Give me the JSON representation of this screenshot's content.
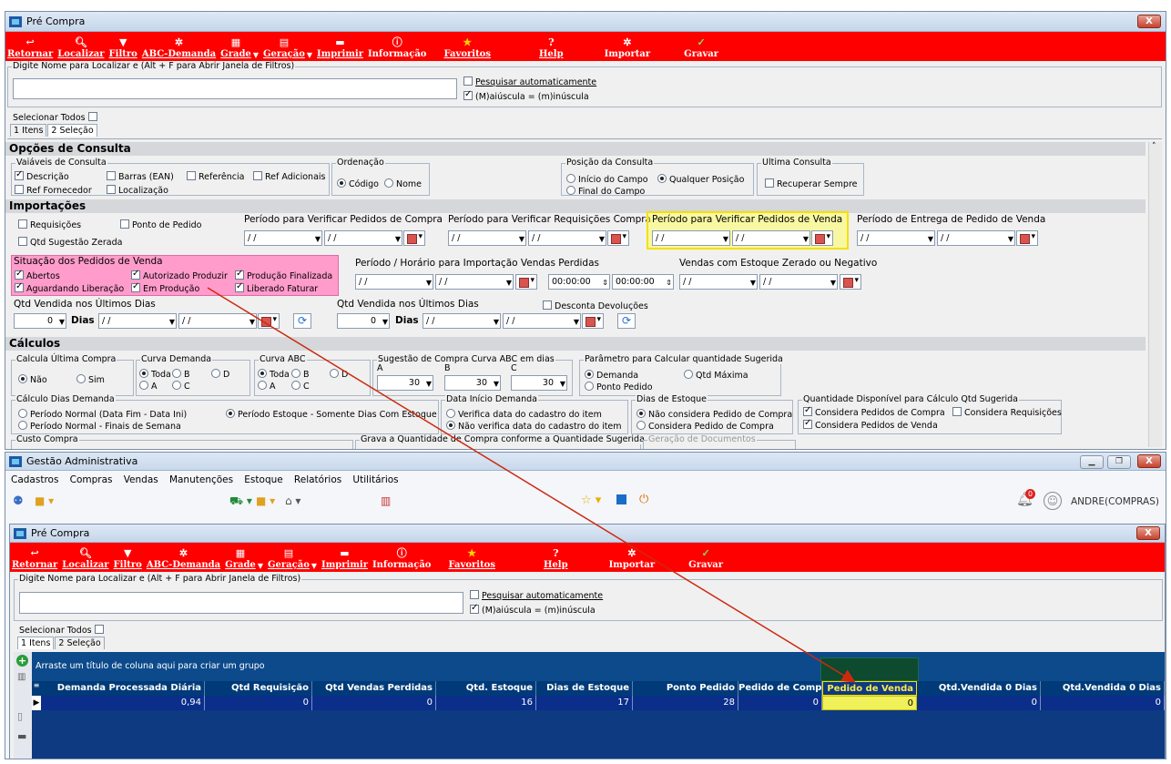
{
  "window_top": {
    "title": "Pré Compra",
    "close_label": "X",
    "toolbar": [
      "Retornar",
      "Localizar",
      "Filtro",
      "ABC-Demanda",
      "Grade",
      "Geração",
      "Imprimir",
      "Informação",
      "Favoritos",
      "Help",
      "Importar",
      "Gravar"
    ],
    "search_label": "Digite Nome para Localizar e (Alt + F para Abrir Janela de Filtros)",
    "auto_search": "Pesquisar automaticamente",
    "case_option": "(M)aiúscula = (m)inúscula",
    "select_all": "Selecionar Todos",
    "tabs": [
      "1 Itens",
      "2 Seleção"
    ],
    "sections": {
      "opcoes": "Opções de Consulta",
      "importacoes": "Importações",
      "calculos": "Cálculos"
    },
    "variaveis": {
      "label": "Vaiáveis de Consulta",
      "options": [
        "Descrição",
        "Barras (EAN)",
        "Referência",
        "Ref Adicionais",
        "Ref Fornecedor",
        "Localização"
      ]
    },
    "ordenacao": {
      "label": "Ordenação",
      "options": [
        "Código",
        "Nome"
      ]
    },
    "posicao": {
      "label": "Posição da Consulta",
      "options": [
        "Início do Campo",
        "Qualquer Posição",
        "Final do Campo"
      ]
    },
    "ultima": {
      "label": "Ultima Consulta",
      "option": "Recuperar Sempre"
    },
    "import_opts": [
      "Requisições",
      "Ponto de Pedido",
      "Qtd Sugestão Zerada"
    ],
    "period_labels": [
      "Período para Verificar Pedidos de Compra",
      "Período para Verificar Requisições Compra",
      "Período para Verificar Pedidos de  Venda",
      "Período de Entrega de Pedido de Venda"
    ],
    "date_placeholder": "/ /",
    "situacao": {
      "label": "Situação dos Pedidos de Venda",
      "options": [
        "Abertos",
        "Autorizado Produzir",
        "Produção Finalizada",
        "Aguardando Liberação",
        "Em Produção",
        "Liberado Faturar"
      ]
    },
    "vendas_perdidas_label": "Período / Horário para Importação Vendas Perdidas",
    "time_value": "00:00:00",
    "estoque_zerado_label": "Vendas com Estoque Zerado ou Negativo",
    "qtd_vendida_label": "Qtd Vendida nos Últimos Dias",
    "qtd_value": "0",
    "dias_label": "Dias",
    "desconta": "Desconta Devoluções",
    "calcula_ultima": {
      "label": "Calcula Última Compra",
      "options": [
        "Não",
        "Sim"
      ]
    },
    "curva_demanda": {
      "label": "Curva Demanda",
      "options": [
        "Toda",
        "B",
        "D",
        "A",
        "C"
      ]
    },
    "curva_abc": {
      "label": "Curva ABC",
      "options": [
        "Toda",
        "B",
        "D",
        "A",
        "C"
      ]
    },
    "sugestao": {
      "label": "Sugestão de Compra Curva ABC em  dias",
      "letters": [
        "A",
        "B",
        "C"
      ],
      "values": [
        "30",
        "30",
        "30"
      ]
    },
    "parametro": {
      "label": "Parâmetro para Calcular quantidade Sugerida",
      "options": [
        "Demanda",
        "Qtd Máxima",
        "Ponto Pedido"
      ]
    },
    "calculo_dias": {
      "label": "Cálculo Dias Demanda",
      "options": [
        "Período Normal (Data Fim - Data Ini)",
        "Período Estoque - Somente Dias Com Estoque",
        "Período Normal - Finais de Semana"
      ]
    },
    "data_inicio": {
      "label": "Data Início Demanda",
      "options": [
        "Verifica data do cadastro do item",
        "Não verifica data do cadastro do item"
      ]
    },
    "dias_estoque": {
      "label": "Dias de Estoque",
      "options": [
        "Não considera Pedido de Compra",
        "Considera Pedido de Compra"
      ]
    },
    "qtd_disponivel": {
      "label": "Quantidade Disponível para Cálculo Qtd Sugerida",
      "options": [
        "Considera Pedidos de Compra",
        "Considera Requisições",
        "Considera Pedidos de Venda"
      ]
    },
    "bottom_labels": [
      "Custo Compra",
      "Grava a Quantidade de Compra conforme a Quantidade Sugerida",
      "Geração de Documentos"
    ]
  },
  "window_main": {
    "title": "Gestão Administrativa",
    "menu": [
      "Cadastros",
      "Compras",
      "Vendas",
      "Manutenções",
      "Estoque",
      "Relatórios",
      "Utilitários"
    ],
    "user": "ANDRE(COMPRAS)",
    "notif_count": "0"
  },
  "window_inner": {
    "title": "Pré Compra",
    "group_hint": "Arraste um título de coluna aqui para criar um grupo",
    "columns": [
      "Demanda Processada Diária",
      "Qtd Requisição",
      "Qtd Vendas Perdidas",
      "Qtd. Estoque",
      "Dias de Estoque",
      "Ponto Pedido",
      "Pedido de Comp",
      "Pedido de Venda",
      "Qtd.Vendida 0 Dias",
      "Qtd.Vendida 0 Dias"
    ],
    "row": [
      "0,94",
      "0",
      "0",
      "16",
      "17",
      "28",
      "0",
      "0",
      "0",
      "0"
    ]
  },
  "colors": {
    "toolbar": "#ff0000",
    "grid_header": "#003a78",
    "highlight": "#f6e000",
    "pink": "#ff9ccb",
    "arrow": "#cc2a10"
  }
}
